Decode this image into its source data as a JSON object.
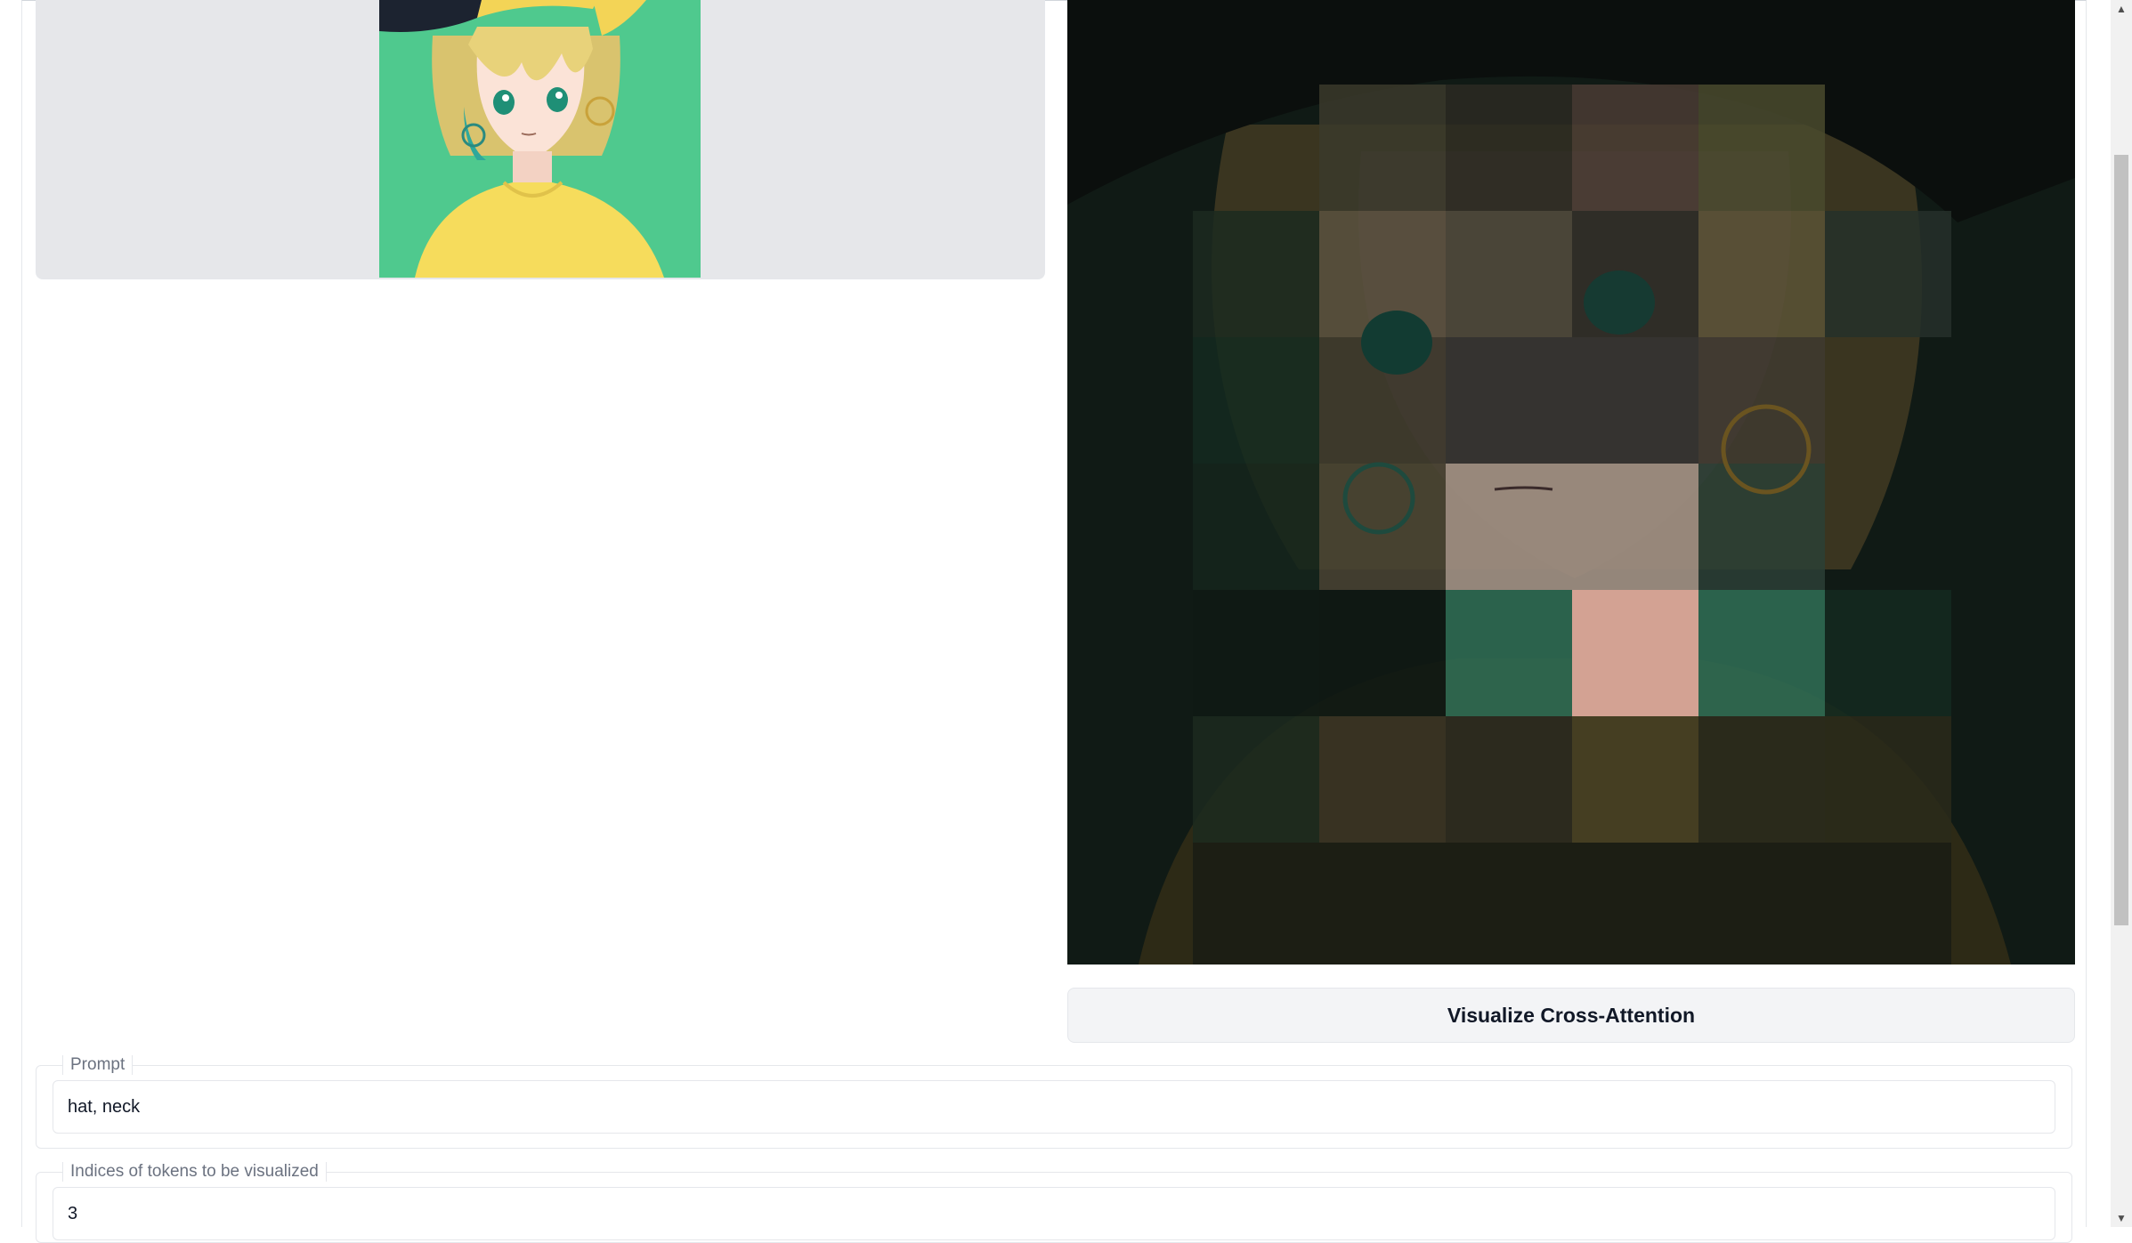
{
  "output": {
    "button_label": "Visualize Cross-Attention"
  },
  "prompt_field": {
    "label": "Prompt",
    "value": "hat, neck"
  },
  "indices_field": {
    "label": "Indices of tokens to be visualized",
    "value": "3"
  },
  "images": {
    "input": "anime girl with blonde bob hair, yellow cap, hoop earrings, yellow t-shirt on green background",
    "output": "cross-attention heatmap overlay on the generated anime girl image"
  },
  "colors": {
    "accent_bg": "#f3f4f6",
    "panel_bg": "#e6e7ea",
    "border": "#e5e7eb",
    "label": "#6b7280"
  }
}
